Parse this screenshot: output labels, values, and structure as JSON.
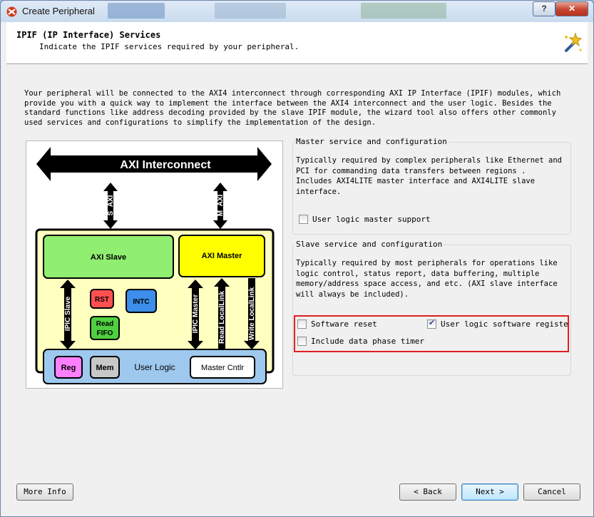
{
  "window": {
    "title": "Create Peripheral",
    "help_label": "?",
    "close_label": "✕",
    "colors": {
      "close": "#c5432d",
      "titlebar": "#c9dbee"
    }
  },
  "header": {
    "title": "IPIF (IP Interface) Services",
    "subtitle": "Indicate the IPIF services required by your peripheral.",
    "icon": "wizard-wand-icon"
  },
  "intro_text": "Your peripheral will be connected to the AXI4 interconnect through corresponding AXI IP Interface (IPIF) modules, which\nprovide you with a quick way to implement the interface between the AXI4 interconnect and the user logic. Besides the\nstandard functions like address decoding provided by the slave IPIF module, the wizard tool also offers other commonly\nused services and configurations to simplify the implementation of the design.",
  "diagram": {
    "interconnect": "AXI Interconnect",
    "s_axi": "S_AXI",
    "m_axi": "M_AXI",
    "axi_slave": "AXI Slave",
    "axi_master": "AXI Master",
    "rst": "RST",
    "intc": "INTC",
    "read_fifo_1": "Read",
    "read_fifo_2": "FIFO",
    "ipic_slave": "IPIC Slave",
    "ipic_master": "IPIC Master",
    "read_locallink": "Read LocalLink",
    "write_locallink": "Write LocalLink",
    "reg": "Reg",
    "mem": "Mem",
    "user_logic": "User Logic",
    "master_cntlr": "Master Cntlr",
    "colors": {
      "outer": "#ffffc0",
      "slave": "#90ee70",
      "master": "#ffff00",
      "rst": "#ff5050",
      "intc": "#3d8eea",
      "fifo": "#50d040",
      "user_logic": "#9ec8ee",
      "reg": "#ff80ff",
      "mem": "#c8c8c8"
    }
  },
  "master_group": {
    "title": "Master service and configuration",
    "text": "Typically required by complex peripherals like Ethernet and\nPCI for commanding data transfers between regions .\nIncludes AXI4LITE master interface and AXI4LITE slave\ninterface.",
    "user_logic_master_support": {
      "label": "User logic master support",
      "checked": false
    }
  },
  "slave_group": {
    "title": "Slave service and configuration",
    "text": "Typically required by most peripherals for operations like\nlogic control, status report, data buffering, multiple\nmemory/address space access, and etc. (AXI slave interface\nwill always be included).",
    "software_reset": {
      "label": "Software reset",
      "checked": false
    },
    "user_logic_software_register": {
      "label": "User logic software registe",
      "checked": true
    },
    "include_data_phase_timer": {
      "label": "Include data phase timer",
      "checked": false
    }
  },
  "footer": {
    "more_info": "More Info",
    "back": "< Back",
    "next": "Next >",
    "cancel": "Cancel"
  }
}
